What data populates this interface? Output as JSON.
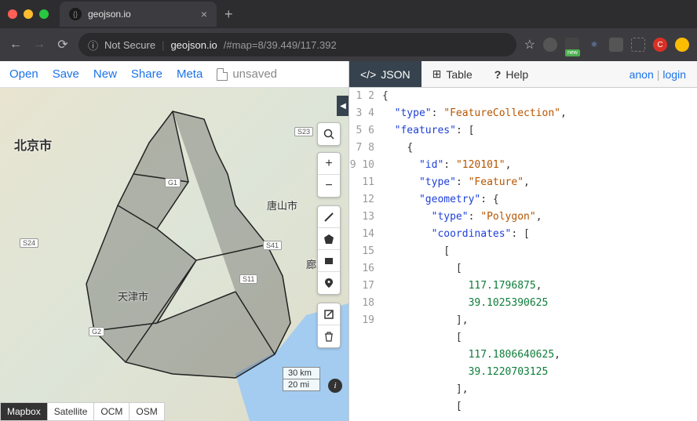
{
  "browser": {
    "tab_title": "geojson.io",
    "not_secure": "Not Secure",
    "url_host": "geojson.io",
    "url_path": "/#map=8/39.449/117.392",
    "ext_new": "new"
  },
  "menu": {
    "open": "Open",
    "save": "Save",
    "new": "New",
    "share": "Share",
    "meta": "Meta",
    "unsaved": "unsaved"
  },
  "map": {
    "city1": "北京市",
    "city2": "唐山市",
    "city3": "天津市",
    "city4": "廊坊",
    "road_s23": "S23",
    "road_g1": "G1",
    "road_s24": "S24",
    "road_s41": "S41",
    "road_s11": "S11",
    "road_g2": "G2",
    "scale_km": "30 km",
    "scale_mi": "20 mi",
    "layers": {
      "mapbox": "Mapbox",
      "satellite": "Satellite",
      "ocm": "OCM",
      "osm": "OSM"
    }
  },
  "tabs": {
    "json": "JSON",
    "table": "Table",
    "help": "Help",
    "anon": "anon",
    "login": "login"
  },
  "geojson": {
    "lines": [
      {
        "n": 1,
        "indent": 0,
        "parts": [
          {
            "t": "punc",
            "v": "{"
          }
        ]
      },
      {
        "n": 2,
        "indent": 1,
        "parts": [
          {
            "t": "key",
            "v": "\"type\""
          },
          {
            "t": "punc",
            "v": ": "
          },
          {
            "t": "str",
            "v": "\"FeatureCollection\""
          },
          {
            "t": "punc",
            "v": ","
          }
        ]
      },
      {
        "n": 3,
        "indent": 1,
        "parts": [
          {
            "t": "key",
            "v": "\"features\""
          },
          {
            "t": "punc",
            "v": ": ["
          }
        ]
      },
      {
        "n": 4,
        "indent": 2,
        "parts": [
          {
            "t": "punc",
            "v": "{"
          }
        ]
      },
      {
        "n": 5,
        "indent": 3,
        "parts": [
          {
            "t": "key",
            "v": "\"id\""
          },
          {
            "t": "punc",
            "v": ": "
          },
          {
            "t": "str",
            "v": "\"120101\""
          },
          {
            "t": "punc",
            "v": ","
          }
        ]
      },
      {
        "n": 6,
        "indent": 3,
        "parts": [
          {
            "t": "key",
            "v": "\"type\""
          },
          {
            "t": "punc",
            "v": ": "
          },
          {
            "t": "str",
            "v": "\"Feature\""
          },
          {
            "t": "punc",
            "v": ","
          }
        ]
      },
      {
        "n": 7,
        "indent": 3,
        "parts": [
          {
            "t": "key",
            "v": "\"geometry\""
          },
          {
            "t": "punc",
            "v": ": {"
          }
        ]
      },
      {
        "n": 8,
        "indent": 4,
        "parts": [
          {
            "t": "key",
            "v": "\"type\""
          },
          {
            "t": "punc",
            "v": ": "
          },
          {
            "t": "str",
            "v": "\"Polygon\""
          },
          {
            "t": "punc",
            "v": ","
          }
        ]
      },
      {
        "n": 9,
        "indent": 4,
        "parts": [
          {
            "t": "key",
            "v": "\"coordinates\""
          },
          {
            "t": "punc",
            "v": ": ["
          }
        ]
      },
      {
        "n": 10,
        "indent": 5,
        "parts": [
          {
            "t": "punc",
            "v": "["
          }
        ]
      },
      {
        "n": 11,
        "indent": 6,
        "parts": [
          {
            "t": "punc",
            "v": "["
          }
        ]
      },
      {
        "n": 12,
        "indent": 7,
        "parts": [
          {
            "t": "num",
            "v": "117.1796875"
          },
          {
            "t": "punc",
            "v": ","
          }
        ]
      },
      {
        "n": 13,
        "indent": 7,
        "parts": [
          {
            "t": "num",
            "v": "39.1025390625"
          }
        ]
      },
      {
        "n": 14,
        "indent": 6,
        "parts": [
          {
            "t": "punc",
            "v": "],"
          }
        ]
      },
      {
        "n": 15,
        "indent": 6,
        "parts": [
          {
            "t": "punc",
            "v": "["
          }
        ]
      },
      {
        "n": 16,
        "indent": 7,
        "parts": [
          {
            "t": "num",
            "v": "117.1806640625"
          },
          {
            "t": "punc",
            "v": ","
          }
        ]
      },
      {
        "n": 17,
        "indent": 7,
        "parts": [
          {
            "t": "num",
            "v": "39.1220703125"
          }
        ]
      },
      {
        "n": 18,
        "indent": 6,
        "parts": [
          {
            "t": "punc",
            "v": "],"
          }
        ]
      },
      {
        "n": 19,
        "indent": 6,
        "parts": [
          {
            "t": "punc",
            "v": "["
          }
        ]
      }
    ]
  }
}
